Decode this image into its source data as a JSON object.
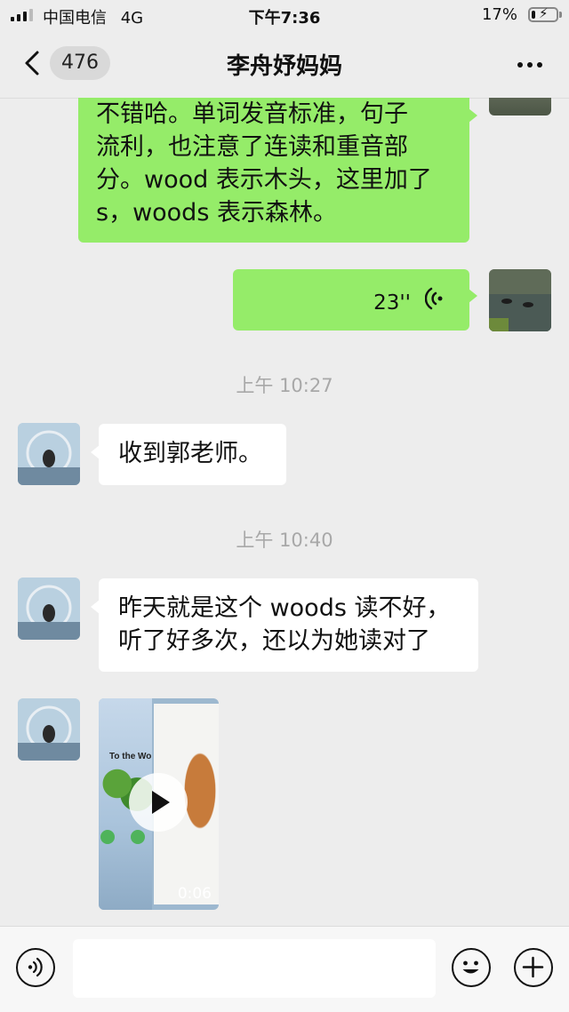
{
  "status_bar": {
    "carrier": "中国电信",
    "network": "4G",
    "time": "下午7:36",
    "battery_percent": "17%",
    "battery_level": 0.17
  },
  "nav": {
    "unread_count": "476",
    "title": "李舟妤妈妈"
  },
  "messages": [
    {
      "from": "me",
      "type": "text",
      "text": "不错哈。单词发音标准，句子\n流利，也注意了连读和重音部\n分。wood 表示木头，这里加了\ns，woods 表示森林。"
    },
    {
      "from": "me",
      "type": "voice",
      "duration": "23''"
    },
    {
      "type": "time",
      "text": "上午 10:27"
    },
    {
      "from": "them",
      "type": "text",
      "text": "收到郭老师。"
    },
    {
      "type": "time",
      "text": "上午 10:40"
    },
    {
      "from": "them",
      "type": "text",
      "text": "昨天就是这个 woods 读不好，\n听了好多次，还以为她读对了"
    },
    {
      "from": "them",
      "type": "video",
      "book_title": "To the Wo",
      "duration": "0:06"
    }
  ],
  "input_bar": {
    "icons": [
      "voice-icon",
      "emoji-icon",
      "plus-icon"
    ]
  },
  "colors": {
    "background": "#ededed",
    "own_bubble": "#95ec69",
    "other_bubble": "#ffffff"
  }
}
